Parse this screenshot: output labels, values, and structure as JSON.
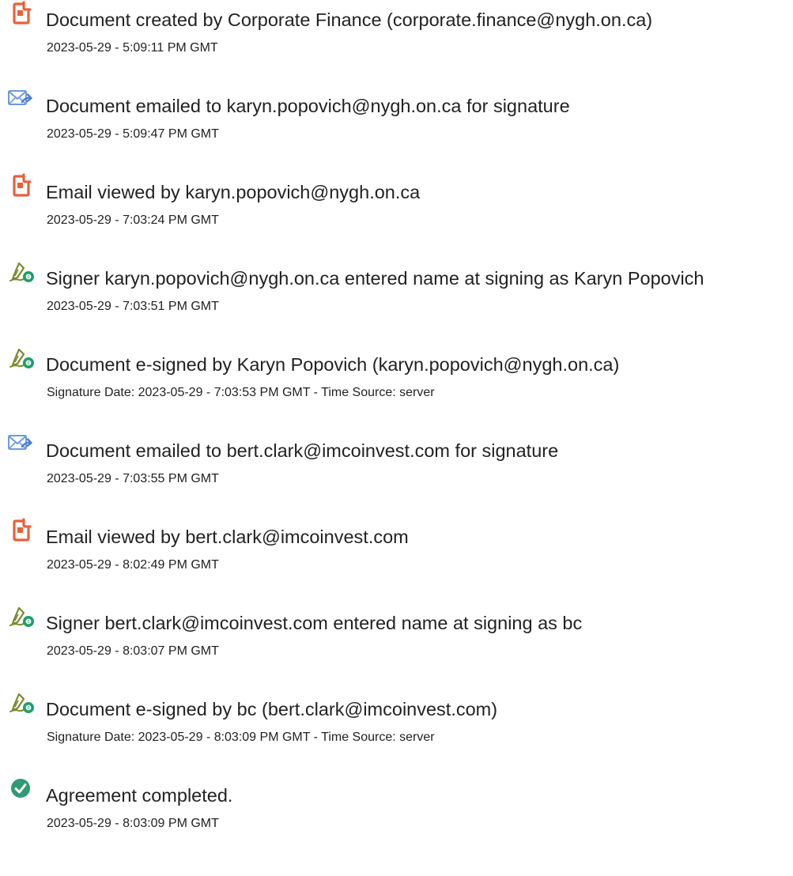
{
  "events": [
    {
      "icon": "document-icon",
      "text": "Document created by Corporate Finance (corporate.finance@nygh.on.ca)",
      "detail": "2023-05-29 - 5:09:11 PM GMT"
    },
    {
      "icon": "email-sent-icon",
      "text": "Document emailed to karyn.popovich@nygh.on.ca for signature",
      "detail": "2023-05-29 - 5:09:47 PM GMT"
    },
    {
      "icon": "document-icon",
      "text": "Email viewed by karyn.popovich@nygh.on.ca",
      "detail": "2023-05-29 - 7:03:24 PM GMT"
    },
    {
      "icon": "e-sign-icon",
      "text": "Signer karyn.popovich@nygh.on.ca entered name at signing as Karyn Popovich",
      "detail": "2023-05-29 - 7:03:51 PM GMT"
    },
    {
      "icon": "e-sign-icon",
      "text": "Document e-signed by Karyn Popovich (karyn.popovich@nygh.on.ca)",
      "detail": "Signature Date: 2023-05-29 - 7:03:53 PM GMT - Time Source: server"
    },
    {
      "icon": "email-sent-icon",
      "text": "Document emailed to bert.clark@imcoinvest.com for signature",
      "detail": "2023-05-29 - 7:03:55 PM GMT"
    },
    {
      "icon": "document-icon",
      "text": "Email viewed by bert.clark@imcoinvest.com",
      "detail": "2023-05-29 - 8:02:49 PM GMT"
    },
    {
      "icon": "e-sign-icon",
      "text": "Signer bert.clark@imcoinvest.com entered name at signing as bc",
      "detail": "2023-05-29 - 8:03:07 PM GMT"
    },
    {
      "icon": "e-sign-icon",
      "text": "Document e-signed by bc (bert.clark@imcoinvest.com)",
      "detail": "Signature Date: 2023-05-29 - 8:03:09 PM GMT - Time Source: server"
    },
    {
      "icon": "check-circle-icon",
      "text": "Agreement completed.",
      "detail": "2023-05-29 - 8:03:09 PM GMT"
    }
  ],
  "colors": {
    "document": "#e8603a",
    "email": "#5b8fd6",
    "sign_pen": "#6b7a2a",
    "sign_badge": "#1f9f6b",
    "check": "#2e9b73"
  }
}
